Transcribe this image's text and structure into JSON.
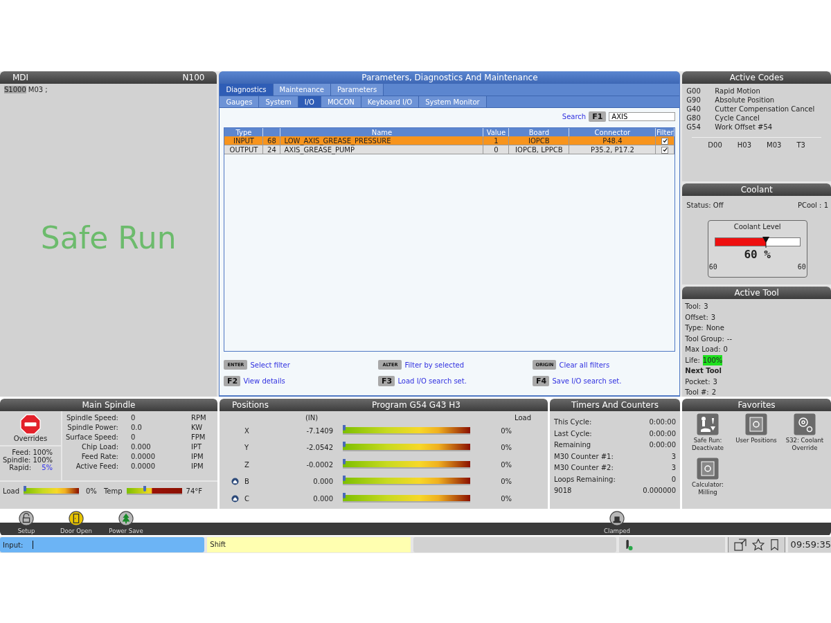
{
  "mdi": {
    "title": "MDI",
    "block": "N100",
    "program": [
      {
        "text": "S1000",
        "highlighted": true
      },
      {
        "text": "M03 ;",
        "highlighted": false
      }
    ],
    "mode": "Safe Run"
  },
  "pdm": {
    "title": "Parameters, Diagnostics And Maintenance",
    "tabs": [
      {
        "label": "Diagnostics",
        "selected": true
      },
      {
        "label": "Maintenance",
        "selected": false
      },
      {
        "label": "Parameters",
        "selected": false
      }
    ],
    "subtabs": [
      {
        "label": "Gauges",
        "selected": false
      },
      {
        "label": "System",
        "selected": false
      },
      {
        "label": "I/O",
        "selected": true
      },
      {
        "label": "MOCON",
        "selected": false
      },
      {
        "label": "Keyboard I/O",
        "selected": false
      },
      {
        "label": "System Monitor",
        "selected": false
      }
    ],
    "search": {
      "label": "Search",
      "key": "F1",
      "value": "AXIS"
    },
    "table": {
      "columns": [
        "Type",
        "",
        "Name",
        "Value",
        "Board",
        "Connector",
        "Filter"
      ],
      "rows": [
        {
          "type": "INPUT",
          "number": "68",
          "name": "LOW_AXIS_GREASE_PRESSURE",
          "value": "1",
          "board": "IOPCB",
          "connector": "P48.4",
          "checked": true,
          "selected": true
        },
        {
          "type": "OUTPUT",
          "number": "24",
          "name": "AXIS_GREASE_PUMP",
          "value": "0",
          "board": "IOPCB, LPPCB",
          "connector": "P35.2, P17.2",
          "checked": true,
          "selected": false
        }
      ]
    },
    "hints": [
      {
        "key": "ENTER",
        "kind": "small",
        "label": "Select filter"
      },
      {
        "key": "ALTER",
        "kind": "small",
        "label": "Filter by selected"
      },
      {
        "key": "ORIGIN",
        "kind": "small",
        "label": "Clear all filters"
      },
      {
        "key": "F2",
        "kind": "f",
        "label": "View details"
      },
      {
        "key": "F3",
        "kind": "f",
        "label": "Load I/O search set."
      },
      {
        "key": "F4",
        "kind": "f",
        "label": "Save I/O search set."
      }
    ]
  },
  "active_codes": {
    "title": "Active Codes",
    "codes": [
      {
        "code": "G00",
        "text": "Rapid Motion"
      },
      {
        "code": "G90",
        "text": "Absolute Position"
      },
      {
        "code": "G40",
        "text": "Cutter Compensation Cancel"
      },
      {
        "code": "G80",
        "text": "Cycle Cancel"
      },
      {
        "code": "G54",
        "text": "Work Offset #54"
      }
    ],
    "others": [
      "D00",
      "H03",
      "M03",
      "T3"
    ]
  },
  "coolant": {
    "title": "Coolant",
    "status": "Status: Off",
    "pcool": "PCool : 1",
    "gauge_title": "Coolant Level",
    "level": 0.6,
    "reading": "60 %",
    "min": "60",
    "max": "60"
  },
  "active_tool": {
    "title": "Active Tool",
    "lines": [
      {
        "kind": "field",
        "label": "Tool:",
        "value": "3",
        "highlight": false
      },
      {
        "kind": "field",
        "label": "Offset:",
        "value": "3",
        "highlight": false
      },
      {
        "kind": "field",
        "label": "Type:",
        "value": "None",
        "highlight": false
      },
      {
        "kind": "field",
        "label": "Tool Group:",
        "value": "--",
        "highlight": false
      },
      {
        "kind": "field",
        "label": "Max Load:",
        "value": "0",
        "highlight": false
      },
      {
        "kind": "field",
        "label": "Life:",
        "value": "100%",
        "highlight": true
      },
      {
        "kind": "heading",
        "label": "Next Tool"
      },
      {
        "kind": "field",
        "label": "Pocket:",
        "value": "3",
        "highlight": false
      },
      {
        "kind": "field",
        "label": "Tool #:",
        "value": "2",
        "highlight": false
      }
    ]
  },
  "spindle": {
    "title": "Main Spindle",
    "overrides_label": "Overrides",
    "overrides": [
      {
        "label": "Feed:",
        "value": "100%",
        "changed": false
      },
      {
        "label": "Spindle:",
        "value": "100%",
        "changed": false
      },
      {
        "label": "Rapid:",
        "value": "5%",
        "changed": true
      }
    ],
    "stats": [
      {
        "label": "Spindle Speed:",
        "value": "0",
        "unit": "RPM"
      },
      {
        "label": "Spindle Power:",
        "value": "0.0",
        "unit": "KW"
      },
      {
        "label": "Surface Speed:",
        "value": "0",
        "unit": "FPM"
      },
      {
        "label": "Chip Load:",
        "value": "0.000",
        "unit": "IPT"
      },
      {
        "label": "Feed Rate:",
        "value": "0.0000",
        "unit": "IPM"
      },
      {
        "label": "Active Feed:",
        "value": "0.0000",
        "unit": "IPM"
      }
    ],
    "meters": [
      {
        "label": "Load",
        "kind": "load",
        "level": 0,
        "reading": "0%"
      },
      {
        "label": "Temp",
        "kind": "temp",
        "level": 0.3,
        "reading": "74°F"
      }
    ]
  },
  "positions": {
    "title": "Positions",
    "program": "Program G54 G43 H3",
    "unit": "(IN)",
    "load_heading": "Load",
    "axes": [
      {
        "name": "X",
        "value": "-7.1409",
        "home": false,
        "level": 0,
        "reading": "0%"
      },
      {
        "name": "Y",
        "value": "-2.0542",
        "home": false,
        "level": 0,
        "reading": "0%"
      },
      {
        "name": "Z",
        "value": "-0.0002",
        "home": false,
        "level": 0,
        "reading": "0%"
      },
      {
        "name": "B",
        "value": "0.000",
        "home": true,
        "level": 0,
        "reading": "0%"
      },
      {
        "name": "C",
        "value": "0.000",
        "home": true,
        "level": 0,
        "reading": "0%"
      }
    ]
  },
  "timers": {
    "title": "Timers And Counters",
    "rows": [
      {
        "label": "This Cycle:",
        "value": "0:00:00"
      },
      {
        "label": "Last Cycle:",
        "value": "0:00:00"
      },
      {
        "label": "Remaining",
        "value": "0:00:00"
      },
      {
        "label": "M30 Counter #1:",
        "value": "3"
      },
      {
        "label": "M30 Counter #2:",
        "value": "3"
      },
      {
        "label": "Loops Remaining:",
        "value": "0"
      },
      {
        "label": "9018",
        "value": "0.000000"
      }
    ]
  },
  "favorites": {
    "title": "Favorites",
    "items": [
      {
        "kind": "safe-run",
        "label": "Safe Run: Deactivate"
      },
      {
        "kind": "positions",
        "label": "User Positions"
      },
      {
        "kind": "gear",
        "label": "S32: Coolant Override"
      },
      {
        "kind": "calculator",
        "label": "Calculator: Milling"
      }
    ]
  },
  "status_icons": [
    {
      "kind": "lock",
      "label": "Setup"
    },
    {
      "kind": "door",
      "label": "Door Open"
    },
    {
      "kind": "tree",
      "label": "Power Save"
    },
    {
      "kind": "clamp",
      "label": "Clamped"
    }
  ],
  "input_bar": {
    "label": "Input:",
    "shift": "Shift",
    "time": "09:59:35"
  }
}
